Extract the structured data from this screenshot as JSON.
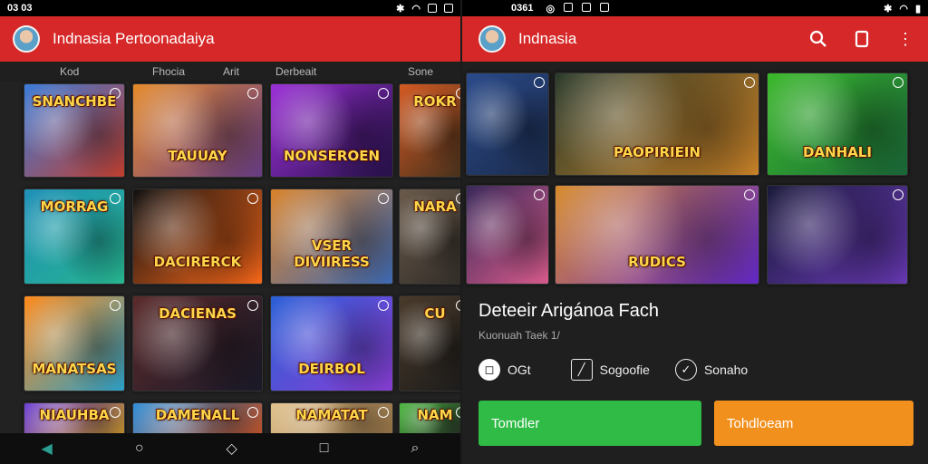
{
  "left": {
    "status": {
      "time": "03 03"
    },
    "appbar": {
      "title": "Indnasia Pertoonadaiya"
    },
    "tabs": [
      "Kod",
      "Fhocia",
      "Arit",
      "Derbeait",
      "Sone"
    ],
    "tiles": [
      {
        "caption": "SNANCHBE",
        "pos": "top",
        "colors": [
          "#3b7bd8",
          "#c23e2e"
        ]
      },
      {
        "caption": "TAUUAY",
        "pos": "bottom",
        "colors": [
          "#e58a2a",
          "#6a3e8a"
        ]
      },
      {
        "caption": "NONSEROEN",
        "pos": "bottom",
        "colors": [
          "#9b2fd6",
          "#26114a"
        ]
      },
      {
        "caption": "ROKR",
        "pos": "top",
        "colors": [
          "#d45a22",
          "#3e2e1c"
        ]
      },
      {
        "caption": "MORRAG",
        "pos": "top",
        "colors": [
          "#1f8fb8",
          "#26b58e"
        ]
      },
      {
        "caption": "DACIRERCK",
        "pos": "bottom",
        "colors": [
          "#111111",
          "#ff6a1a"
        ]
      },
      {
        "caption": "VSER DIVIIRESS",
        "pos": "bottom",
        "colors": [
          "#d9822a",
          "#3d6bb8"
        ]
      },
      {
        "caption": "NARA",
        "pos": "top",
        "colors": [
          "#6a5a4a",
          "#2e2a26"
        ]
      },
      {
        "caption": "MANATSAS",
        "pos": "bottom",
        "colors": [
          "#ff8a1a",
          "#2aa0c8"
        ]
      },
      {
        "caption": "DACIENAS",
        "pos": "top",
        "colors": [
          "#5a2a2a",
          "#1a1a2a"
        ]
      },
      {
        "caption": "DEIRBOL",
        "pos": "bottom",
        "colors": [
          "#2a5fd6",
          "#8a3ed6"
        ]
      },
      {
        "caption": "CU",
        "pos": "top",
        "colors": [
          "#4a3a2a",
          "#1a1a1a"
        ]
      },
      {
        "caption": "NIAUHBA",
        "pos": "top",
        "colors": [
          "#6a3ed6",
          "#d6a02a"
        ]
      },
      {
        "caption": "DAMENALL",
        "pos": "top",
        "colors": [
          "#2a8ad6",
          "#d65a2a"
        ]
      },
      {
        "caption": "NAMATAT",
        "pos": "top",
        "colors": [
          "#e0c08a",
          "#a07a4a"
        ]
      },
      {
        "caption": "NAM",
        "pos": "top",
        "colors": [
          "#4ab83e",
          "#2a2a2a"
        ]
      }
    ]
  },
  "right": {
    "status": {
      "time": "0361"
    },
    "appbar": {
      "title": "Indnasia"
    },
    "tiles": [
      {
        "caption": "",
        "pos": "top",
        "colors": [
          "#2a4a8a",
          "#1a2a4a"
        ]
      },
      {
        "caption": "PAOPIRIEIN",
        "pos": "bottom",
        "colors": [
          "#2a3a2a",
          "#d68a2a"
        ]
      },
      {
        "caption": "DANHALI",
        "pos": "bottom",
        "colors": [
          "#3ab82a",
          "#1a6a3a"
        ]
      },
      {
        "caption": "",
        "pos": "top",
        "colors": [
          "#3a2a5a",
          "#d65a8a"
        ]
      },
      {
        "caption": "RUDICS",
        "pos": "bottom",
        "colors": [
          "#d68a2a",
          "#6a2ad6"
        ]
      },
      {
        "caption": "",
        "pos": "top",
        "colors": [
          "#1a1a3a",
          "#6a3ab8"
        ]
      }
    ],
    "detail": {
      "title": "Deteeir Arigánoa Fach",
      "subtitle": "Kuonuah Taek 1/",
      "stats": [
        {
          "icon": "lock-icon",
          "label": "OGt"
        },
        {
          "icon": "edit-icon",
          "label": "Sogoofie"
        },
        {
          "icon": "check-icon",
          "label": "Sonaho"
        }
      ]
    },
    "buttons": {
      "primary": "Tomdler",
      "secondary": "Tohdloeam"
    }
  }
}
